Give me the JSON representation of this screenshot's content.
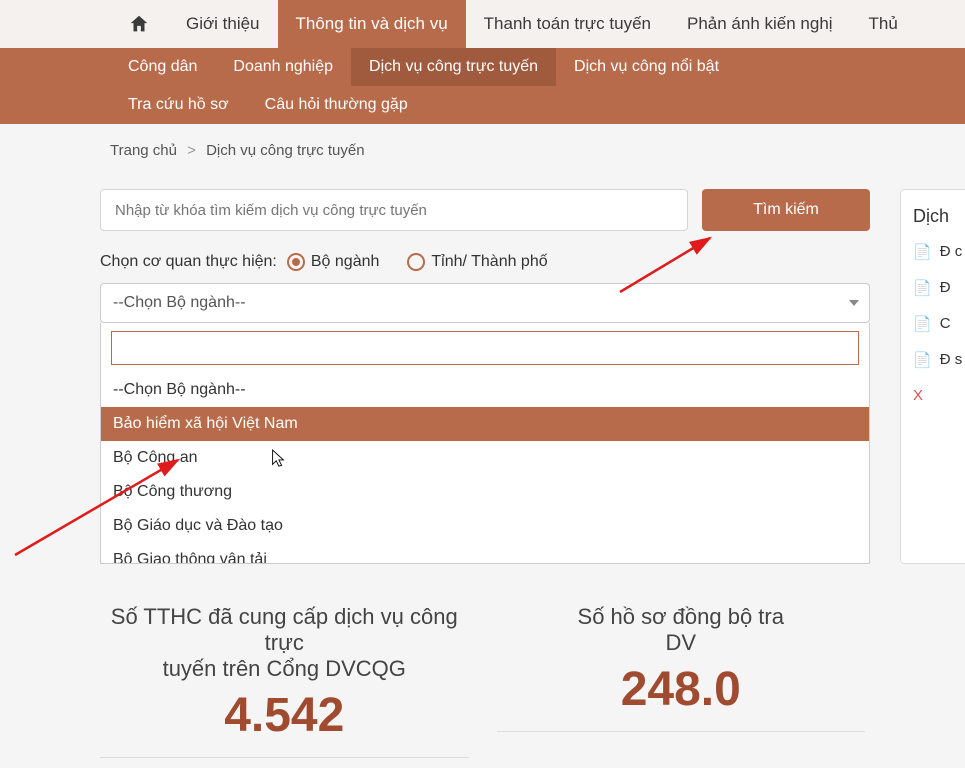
{
  "topnav": {
    "items": [
      "Giới thiệu",
      "Thông tin và dịch vụ",
      "Thanh toán trực tuyến",
      "Phản ánh kiến nghị",
      "Thủ"
    ]
  },
  "subnav": {
    "items": [
      "Công dân",
      "Doanh nghiệp",
      "Dịch vụ công trực tuyến",
      "Dịch vụ công nổi bật",
      "Tra cứu hồ sơ",
      "Câu hỏi thường gặp"
    ]
  },
  "breadcrumb": {
    "home": "Trang chủ",
    "current": "Dịch vụ công trực tuyến"
  },
  "search": {
    "placeholder": "Nhập từ khóa tìm kiếm dịch vụ công trực tuyến",
    "button": "Tìm kiếm"
  },
  "radio": {
    "label": "Chọn cơ quan thực hiện:",
    "opt1": "Bộ ngành",
    "opt2": "Tỉnh/ Thành phố"
  },
  "select": {
    "placeholder": "--Chọn Bộ ngành--",
    "options": [
      "--Chọn Bộ ngành--",
      "Bảo hiểm xã hội Việt Nam",
      "Bộ Công an",
      "Bộ Công thương",
      "Bộ Giáo dục và Đào tạo",
      "Bộ Giao thông vận tải"
    ]
  },
  "sidebar": {
    "title": "Dịch",
    "items": [
      "Đ c",
      "Đ",
      "C",
      "Đ s"
    ],
    "viewall": "X"
  },
  "stats": {
    "card1": {
      "title_l1": "Số TTHC đã cung cấp dịch vụ công trực",
      "title_l2": "tuyến trên Cổng DVCQG",
      "value": "4.542"
    },
    "card2": {
      "title_l1": "Số hồ sơ đồng bộ tra",
      "title_l2": "DV",
      "value": "248.0"
    }
  }
}
